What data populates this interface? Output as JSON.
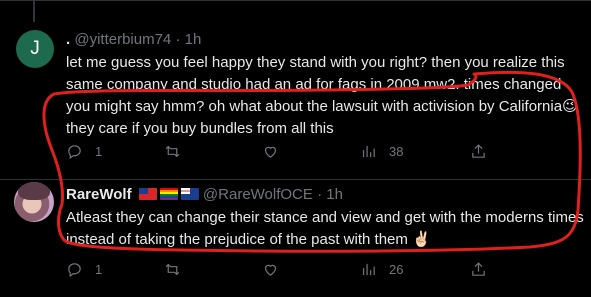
{
  "tweet1": {
    "avatar_initial": "J",
    "display_name": ".",
    "handle": "@yitterbium74",
    "separator": "·",
    "time": "1h",
    "text": "let me guess you feel happy they stand with you right? then you realize this same company and studio had an ad for fags in 2009 mw2. times changed you might say hmm? oh what about the lawsuit with activision by California",
    "emoji": "😉",
    "text_after": "they care if you buy bundles from all this",
    "replies": "1",
    "views": "38",
    "avatar_color": "#1e6a4d"
  },
  "tweet2": {
    "display_name": "RareWolf",
    "flags": [
      "taiwan-flag",
      "rainbow-flag",
      "australia-flag"
    ],
    "handle": "@RareWolfOCE",
    "separator": "·",
    "time": "1h",
    "text": "Atleast they can change their stance and view and get with the moderns times instead of taking the prejudice of the past with them",
    "emoji": "✌🏻",
    "replies": "1",
    "views": "26"
  },
  "colors": {
    "background": "#000000",
    "text": "#e7e9ea",
    "muted": "#71767b",
    "annotation": "#e0201d"
  }
}
